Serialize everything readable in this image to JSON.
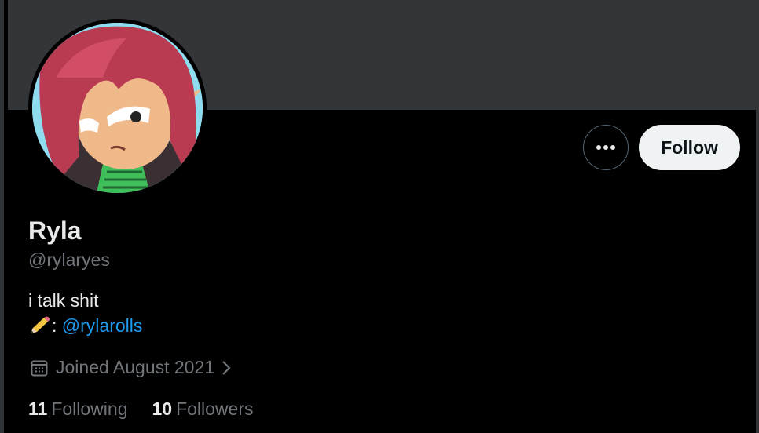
{
  "profile": {
    "display_name": "Ryla",
    "handle": "@rylaryes",
    "bio_line1": "i talk shit",
    "bio_line2_sep": ": ",
    "bio_link": "@rylarolls",
    "joined": "Joined August 2021",
    "following_count": "11",
    "following_label": "Following",
    "followers_count": "10",
    "followers_label": "Followers"
  },
  "actions": {
    "follow_label": "Follow",
    "more_icon": "more-horizontal-icon"
  },
  "colors": {
    "background": "#000000",
    "banner": "#333639",
    "link": "#1d9bf0",
    "muted": "#71767b",
    "follow_bg": "#eff3f4"
  }
}
